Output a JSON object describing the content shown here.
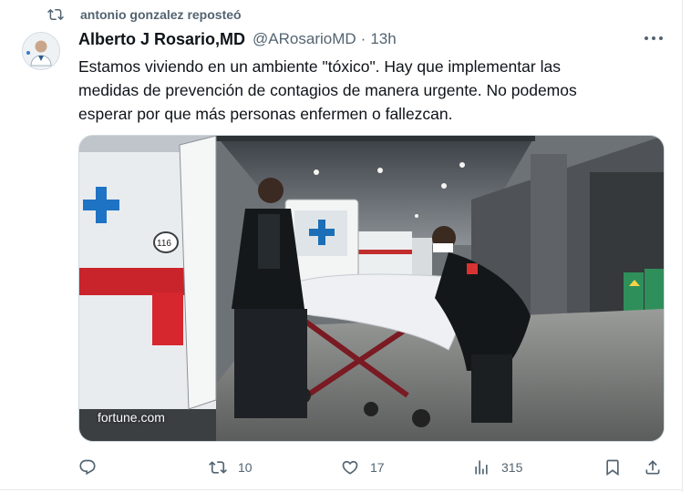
{
  "repost": {
    "icon": "repost-icon",
    "text": "antonio gonzalez reposteó"
  },
  "author": {
    "display_name": "Alberto J Rosario,MD",
    "handle": "@ARosarioMD",
    "separator": "·",
    "time": "13h",
    "avatar_icon": "avatar"
  },
  "tweet": {
    "text": "Estamos viviendo en un ambiente \"tóxico\".  Hay que implementar las\nmedidas de prevención de contagios de manera urgente. No podemos\nesperar por que más personas enfermen o fallezcan."
  },
  "media": {
    "source": "fortune.com"
  },
  "actions": {
    "reply": {
      "icon": "reply-icon"
    },
    "retweet": {
      "icon": "retweet-icon",
      "count": "10"
    },
    "like": {
      "icon": "heart-icon",
      "count": "17"
    },
    "views": {
      "icon": "views-icon",
      "count": "315"
    },
    "bookmark": {
      "icon": "bookmark-icon"
    },
    "share": {
      "icon": "share-icon"
    }
  },
  "colors": {
    "secondary_text": "#536471",
    "primary_text": "#0f1419",
    "divider": "#cfd9de"
  }
}
